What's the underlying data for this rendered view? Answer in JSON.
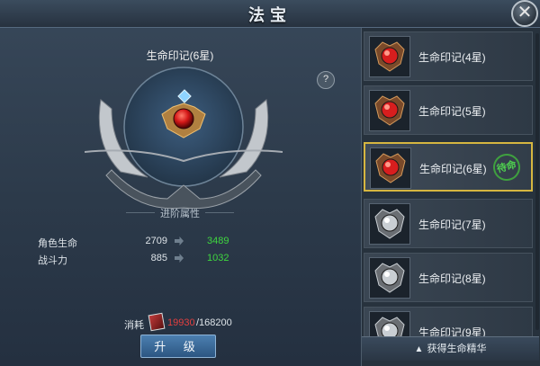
{
  "window": {
    "title": "法宝",
    "close_icon": "crossed-swords-icon"
  },
  "detail": {
    "item_name": "生命印记(6星)",
    "help_label": "?",
    "advanced_label": "进阶属性",
    "stats": [
      {
        "label": "角色生命",
        "current": "2709",
        "next": "3489"
      },
      {
        "label": "战斗力",
        "current": "885",
        "next": "1032"
      }
    ],
    "cost": {
      "label": "消耗",
      "current": "19930",
      "total": "/168200"
    },
    "upgrade_label": "升 级"
  },
  "list": {
    "items": [
      {
        "name": "生命印记(4星)",
        "gem": "red",
        "selected": false
      },
      {
        "name": "生命印记(5星)",
        "gem": "red",
        "selected": false
      },
      {
        "name": "生命印记(6星)",
        "gem": "red",
        "selected": true,
        "badge": "待命"
      },
      {
        "name": "生命印记(7星)",
        "gem": "gray",
        "selected": false
      },
      {
        "name": "生命印记(8星)",
        "gem": "gray",
        "selected": false
      },
      {
        "name": "生命印记(9星)",
        "gem": "gray",
        "selected": false
      }
    ],
    "obtain_label": "获得生命精华"
  },
  "colors": {
    "accent_gold": "#d6b640",
    "green_value": "#3fd63f",
    "red_value": "#e43f3f"
  }
}
